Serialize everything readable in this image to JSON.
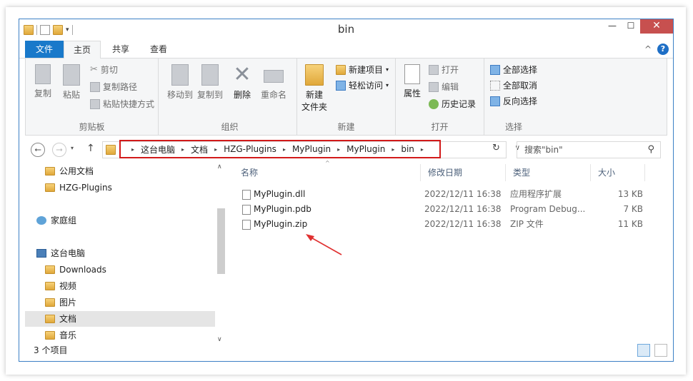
{
  "window": {
    "title": "bin",
    "minimize": "—",
    "maximize": "☐",
    "close": "✕"
  },
  "tabs": {
    "file": "文件",
    "home": "主页",
    "share": "共享",
    "view": "查看",
    "collapse": "^",
    "help": "?"
  },
  "ribbon": {
    "clipboard": {
      "label": "剪贴板",
      "copy": "复制",
      "paste": "粘贴",
      "cut": "剪切",
      "copy_path": "复制路径",
      "paste_shortcut": "粘贴快捷方式"
    },
    "organize": {
      "label": "组织",
      "move_to": "移动到",
      "copy_to": "复制到",
      "delete": "删除",
      "rename": "重命名"
    },
    "new": {
      "label": "新建",
      "new_folder_line1": "新建",
      "new_folder_line2": "文件夹",
      "new_item": "新建项目",
      "easy_access": "轻松访问"
    },
    "open": {
      "label": "打开",
      "properties": "属性",
      "open": "打开",
      "edit": "编辑",
      "history": "历史记录"
    },
    "select": {
      "label": "选择",
      "select_all": "全部选择",
      "select_none": "全部取消",
      "invert": "反向选择"
    }
  },
  "address": {
    "crumbs": [
      "这台电脑",
      "文档",
      "HZG-Plugins",
      "MyPlugin",
      "MyPlugin",
      "bin"
    ],
    "search_placeholder": "搜索\"bin\""
  },
  "nav": {
    "items": [
      {
        "label": "公用文档",
        "icon": "folder-icon"
      },
      {
        "label": "HZG-Plugins",
        "icon": "folder-icon"
      },
      {
        "label": "家庭组",
        "icon": "homegroup-icon"
      },
      {
        "label": "这台电脑",
        "icon": "computer-icon"
      },
      {
        "label": "Downloads",
        "icon": "folder-icon"
      },
      {
        "label": "视频",
        "icon": "folder-icon"
      },
      {
        "label": "图片",
        "icon": "folder-icon"
      },
      {
        "label": "文档",
        "icon": "folder-icon",
        "selected": true
      },
      {
        "label": "音乐",
        "icon": "folder-icon"
      }
    ]
  },
  "columns": {
    "name": "名称",
    "date": "修改日期",
    "type": "类型",
    "size": "大小"
  },
  "files": [
    {
      "name": "MyPlugin.dll",
      "date": "2022/12/11 16:38",
      "type": "应用程序扩展",
      "size": "13 KB"
    },
    {
      "name": "MyPlugin.pdb",
      "date": "2022/12/11 16:38",
      "type": "Program Debug...",
      "size": "7 KB"
    },
    {
      "name": "MyPlugin.zip",
      "date": "2022/12/11 16:38",
      "type": "ZIP 文件",
      "size": "11 KB"
    }
  ],
  "status": {
    "count": "3 个项目"
  },
  "colors": {
    "accent": "#1979ca",
    "highlight_border": "#d21a1a",
    "arrow": "#e03030"
  }
}
